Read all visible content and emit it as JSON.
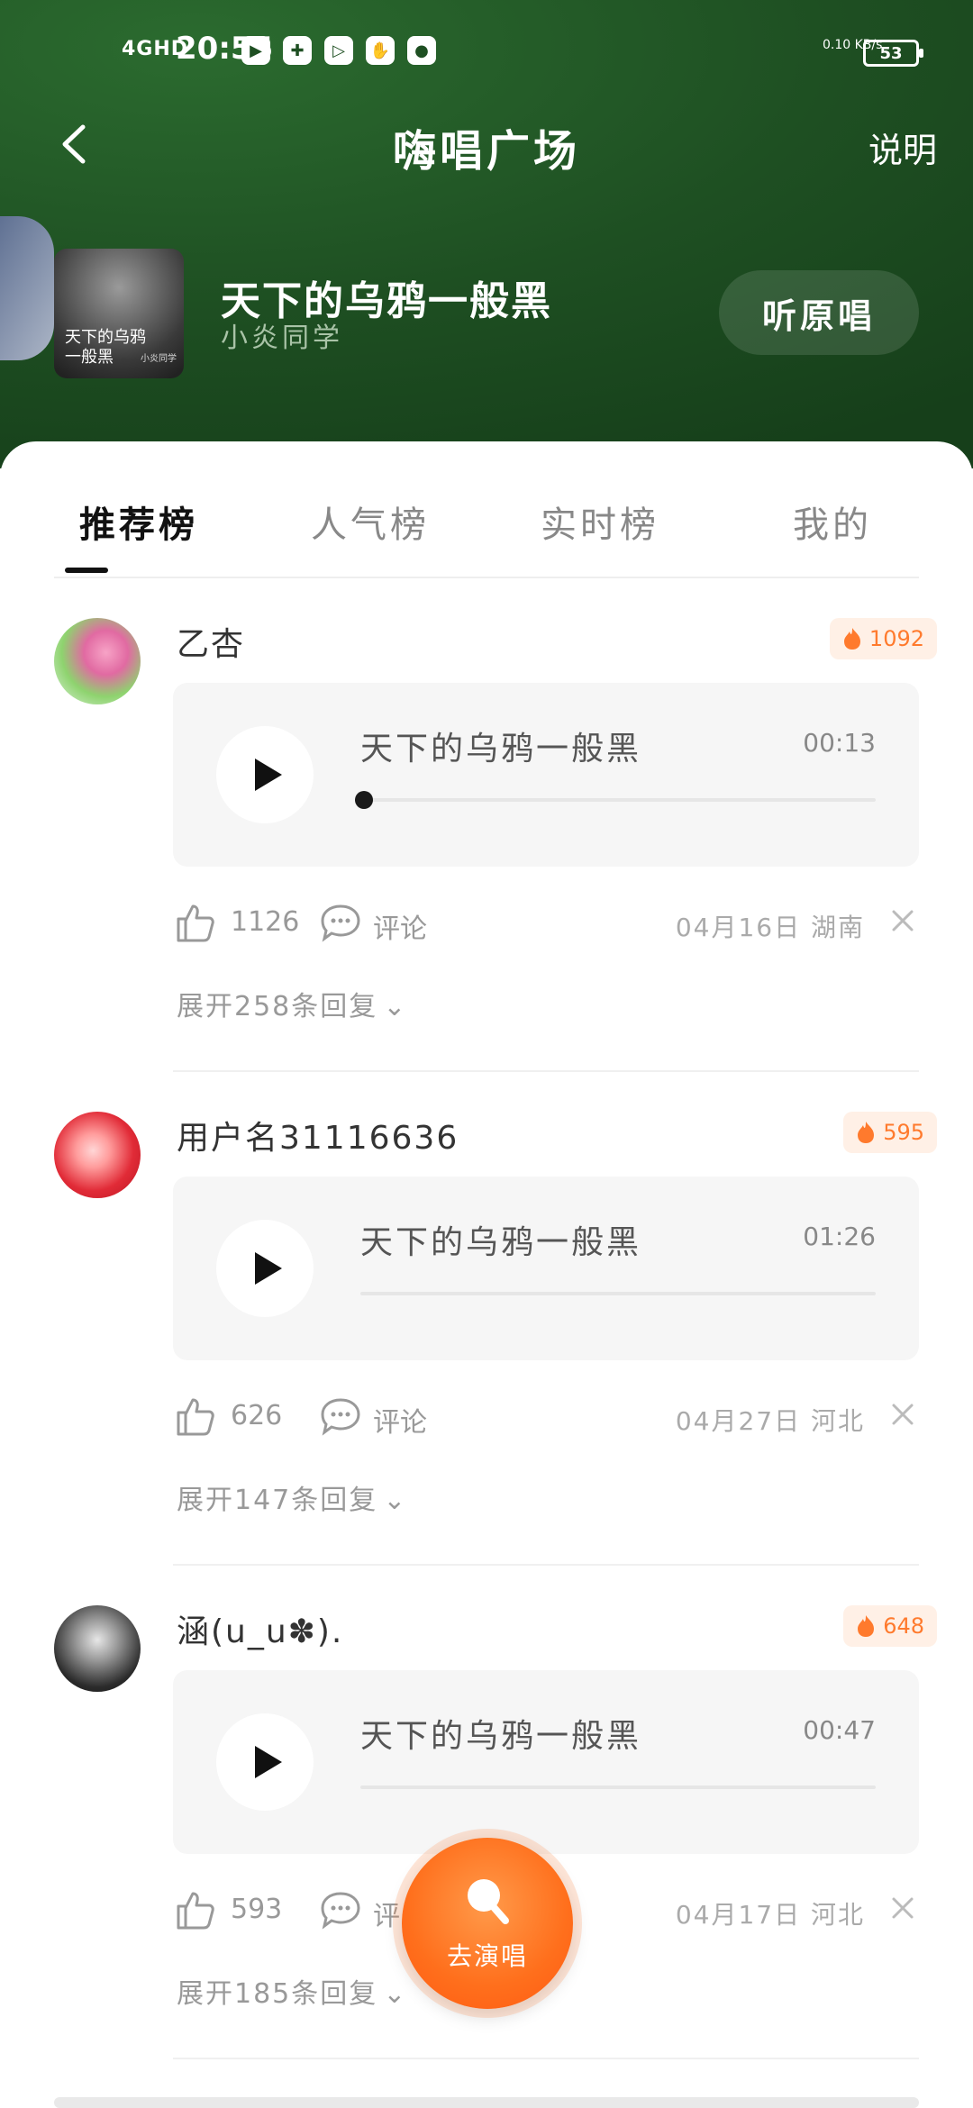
{
  "status_bar": {
    "signal": "4GHD",
    "time": "20:55",
    "net_speed": "0.10\nKB/s",
    "battery": "53",
    "icons": [
      "camera-icon",
      "app-icon",
      "play-icon",
      "handshake-icon",
      "pet-icon"
    ]
  },
  "header": {
    "title": "嗨唱广场",
    "right_link": "说明"
  },
  "song": {
    "title": "天下的乌鸦一般黑",
    "artist": "小炎同学",
    "cover_text": "天下的乌鸦\n一般黑",
    "cover_small": "小炎同学",
    "listen_label": "听原唱"
  },
  "tabs": [
    {
      "label": "推荐榜",
      "active": true
    },
    {
      "label": "人气榜",
      "active": false
    },
    {
      "label": "实时榜",
      "active": false
    },
    {
      "label": "我的",
      "active": false
    }
  ],
  "posts": [
    {
      "user": "乙杏",
      "heat": "1092",
      "track": "天下的乌鸦一般黑",
      "duration": "00:13",
      "progress": 0.0,
      "likes": "1126",
      "comment_label": "评论",
      "meta": "04月16日 湖南",
      "replies": "展开258条回复"
    },
    {
      "user": "用户名31116636",
      "heat": "595",
      "track": "天下的乌鸦一般黑",
      "duration": "01:26",
      "likes": "626",
      "comment_label": "评论",
      "meta": "04月27日 河北",
      "replies": "展开147条回复"
    },
    {
      "user": "涵(u_u✽).",
      "heat": "648",
      "track": "天下的乌鸦一般黑",
      "duration": "00:47",
      "likes": "593",
      "comment_label": "评",
      "meta": "04月17日 河北",
      "replies": "展开185条回复"
    }
  ],
  "fab": {
    "label": "去演唱"
  },
  "colors": {
    "header_green": "#1e4f22",
    "accent_orange": "#ff6f1c",
    "heat_badge_bg": "#fff0e6"
  }
}
